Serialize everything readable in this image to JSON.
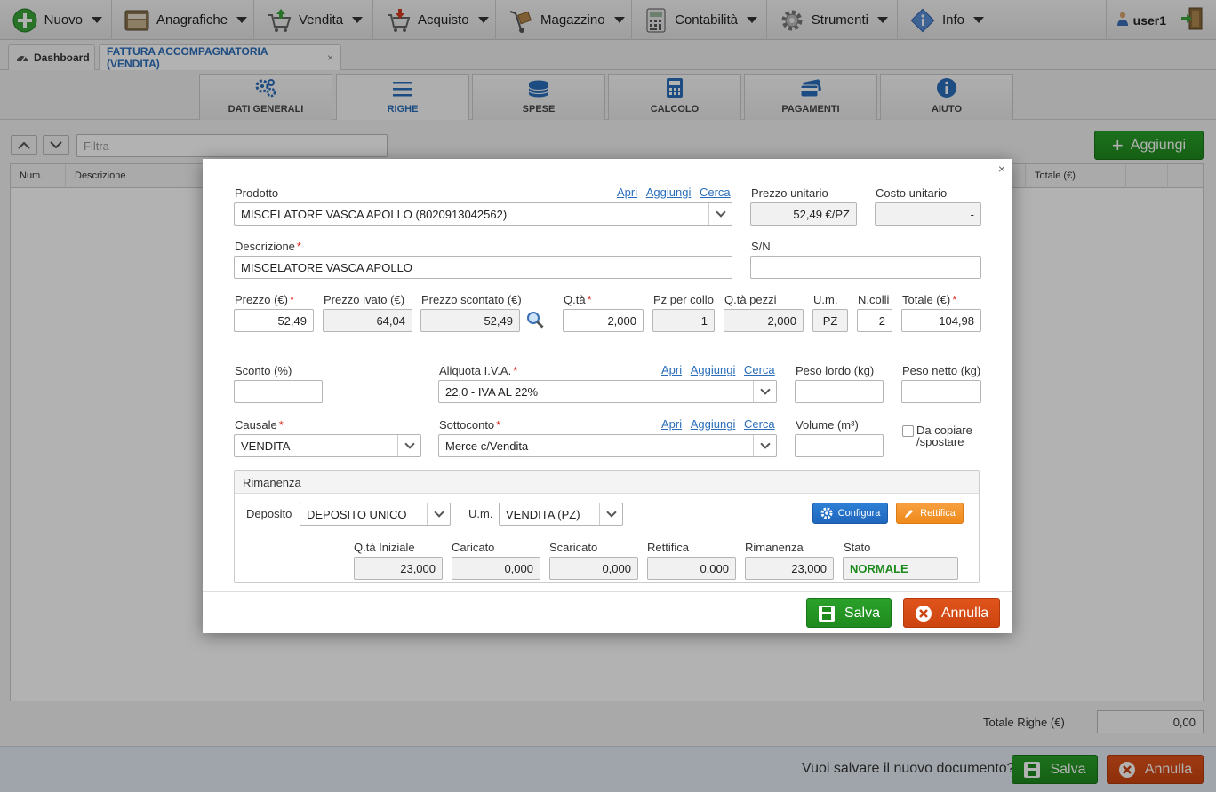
{
  "menubar": {
    "items": [
      {
        "label": "Nuovo",
        "icon": "plus-circle-icon"
      },
      {
        "label": "Anagrafiche",
        "icon": "card-file-icon"
      },
      {
        "label": "Vendita",
        "icon": "cart-up-icon"
      },
      {
        "label": "Acquisto",
        "icon": "cart-down-icon"
      },
      {
        "label": "Magazzino",
        "icon": "hand-truck-icon"
      },
      {
        "label": "Contabilità",
        "icon": "calculator-icon"
      },
      {
        "label": "Strumenti",
        "icon": "gear-icon"
      },
      {
        "label": "Info",
        "icon": "info-diamond-icon"
      }
    ],
    "user": "user1"
  },
  "doc_tabs": {
    "dashboard": "Dashboard",
    "active": "FATTURA ACCOMPAGNATORIA (VENDITA)",
    "close": "×"
  },
  "section_tabs": [
    "DATI GENERALI",
    "RIGHE",
    "SPESE",
    "CALCOLO",
    "PAGAMENTI",
    "AIUTO"
  ],
  "list": {
    "filter_placeholder": "Filtra",
    "add_button": "Aggiungi",
    "columns": {
      "num": "Num.",
      "descrizione": "Descrizione",
      "totale": "Totale (€)"
    },
    "totale_righe_label": "Totale Righe (€)",
    "totale_righe_value": "0,00"
  },
  "footer": {
    "question": "Vuoi salvare il nuovo documento?",
    "save": "Salva",
    "cancel": "Annulla"
  },
  "modal": {
    "close": "×",
    "links": {
      "apri": "Apri",
      "aggiungi": "Aggiungi",
      "cerca": "Cerca"
    },
    "prodotto": {
      "label": "Prodotto",
      "value": "MISCELATORE VASCA APOLLO (8020913042562)"
    },
    "prezzo_unitario": {
      "label": "Prezzo unitario",
      "value": "52,49 €/PZ"
    },
    "costo_unitario": {
      "label": "Costo unitario",
      "value": "-"
    },
    "descrizione": {
      "label": "Descrizione",
      "value": "MISCELATORE VASCA APOLLO"
    },
    "sn": {
      "label": "S/N",
      "value": ""
    },
    "prezzo": {
      "label": "Prezzo (€)",
      "value": "52,49"
    },
    "prezzo_ivato": {
      "label": "Prezzo ivato (€)",
      "value": "64,04"
    },
    "prezzo_scontato": {
      "label": "Prezzo scontato (€)",
      "value": "52,49"
    },
    "qta": {
      "label": "Q.tà",
      "value": "2,000"
    },
    "pz_per_collo": {
      "label": "Pz per collo",
      "value": "1"
    },
    "qta_pezzi": {
      "label": "Q.tà pezzi",
      "value": "2,000"
    },
    "um": {
      "label": "U.m.",
      "value": "PZ"
    },
    "ncolli": {
      "label": "N.colli",
      "value": "2"
    },
    "totale": {
      "label": "Totale (€)",
      "value": "104,98"
    },
    "sconto": {
      "label": "Sconto (%)",
      "value": ""
    },
    "aliquota": {
      "label": "Aliquota I.V.A.",
      "value": "22,0 - IVA AL 22%"
    },
    "peso_lordo": {
      "label": "Peso lordo (kg)",
      "value": ""
    },
    "peso_netto": {
      "label": "Peso netto (kg)",
      "value": ""
    },
    "causale": {
      "label": "Causale",
      "value": "VENDITA"
    },
    "sottoconto": {
      "label": "Sottoconto",
      "value": "Merce c/Vendita"
    },
    "volume": {
      "label": "Volume (m³)",
      "value": ""
    },
    "da_copiare": {
      "line1": "Da copiare",
      "line2": "/spostare"
    },
    "rimanenza": {
      "title": "Rimanenza",
      "deposito_label": "Deposito",
      "deposito_value": "DEPOSITO UNICO",
      "um_label": "U.m.",
      "um_value": "VENDITA (PZ)",
      "configura": "Configura",
      "rettifica_btn": "Rettifica",
      "qta_iniziale": {
        "label": "Q.tà Iniziale",
        "value": "23,000"
      },
      "caricato": {
        "label": "Caricato",
        "value": "0,000"
      },
      "scaricato": {
        "label": "Scaricato",
        "value": "0,000"
      },
      "rettifica": {
        "label": "Rettifica",
        "value": "0,000"
      },
      "rimanenza": {
        "label": "Rimanenza",
        "value": "23,000"
      },
      "stato": {
        "label": "Stato",
        "value": "NORMALE"
      }
    },
    "save": "Salva",
    "cancel": "Annulla"
  },
  "colors": {
    "accent": "#2a6ebb",
    "green": "#1e8a1e",
    "red": "#cc4410",
    "required": "#d9261c"
  }
}
